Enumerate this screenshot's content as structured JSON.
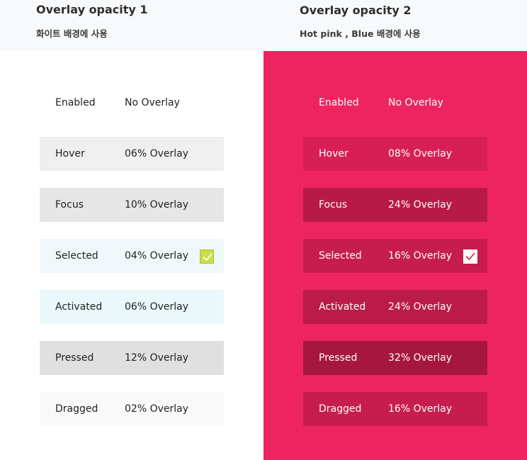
{
  "columns": [
    {
      "title": "Overlay opacity 1",
      "subtitle": "화이트 배경에 사용",
      "background": "#ffffff",
      "rows": [
        {
          "state": "Enabled",
          "overlay": "No Overlay",
          "bg": "#ffffff"
        },
        {
          "state": "Hover",
          "overlay": "06% Overlay",
          "bg": "#efefef"
        },
        {
          "state": "Focus",
          "overlay": "10% Overlay",
          "bg": "#e6e6e6"
        },
        {
          "state": "Selected",
          "overlay": "04% Overlay",
          "bg": "#f0f8fb",
          "checked": true
        },
        {
          "state": "Activated",
          "overlay": "06% Overlay",
          "bg": "#eaf8fb"
        },
        {
          "state": "Pressed",
          "overlay": "12% Overlay",
          "bg": "#e0e0e0"
        },
        {
          "state": "Dragged",
          "overlay": "02% Overlay",
          "bg": "#f9f9f9"
        }
      ]
    },
    {
      "title": "Overlay opacity 2",
      "subtitle": "Hot pink , Blue  배경에 사용",
      "background": "#ee2461",
      "rows": [
        {
          "state": "Enabled",
          "overlay": "No Overlay",
          "bg": "#ee2461"
        },
        {
          "state": "Hover",
          "overlay": "08% Overlay",
          "bg": "#d81f55"
        },
        {
          "state": "Focus",
          "overlay": "24% Overlay",
          "bg": "#b81a47"
        },
        {
          "state": "Selected",
          "overlay": "16% Overlay",
          "bg": "#c71d4e",
          "checked": true
        },
        {
          "state": "Activated",
          "overlay": "24% Overlay",
          "bg": "#bb1b48"
        },
        {
          "state": "Pressed",
          "overlay": "32% Overlay",
          "bg": "#a6173f"
        },
        {
          "state": "Dragged",
          "overlay": "16% Overlay",
          "bg": "#c71d4e"
        }
      ]
    }
  ],
  "icons": {
    "check": "checkbox-checked-icon"
  }
}
